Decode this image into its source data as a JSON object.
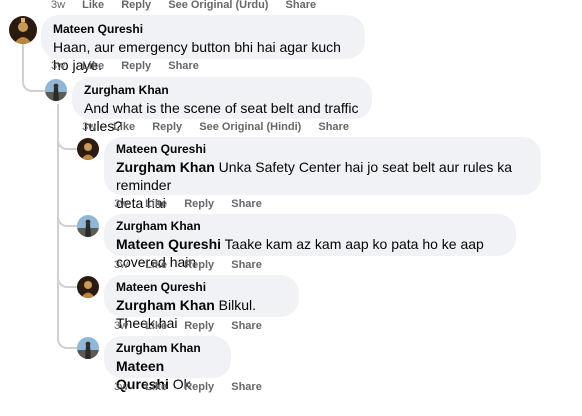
{
  "top_actions": {
    "time": "3w",
    "like": "Like",
    "reply": "Reply",
    "see_original": "See Original (Urdu)",
    "share": "Share"
  },
  "comments": [
    {
      "author": "Mateen Qureshi",
      "text": "Haan, aur emergency button bhi hai agar kuch ho jaye.",
      "time": "3w",
      "like": "Like",
      "reply": "Reply",
      "share": "Share"
    },
    {
      "author": "Zurgham Khan",
      "text": "And what is the scene of seat belt and traffic rules?",
      "time": "3w",
      "like": "Like",
      "reply": "Reply",
      "see_original": "See Original (Hindi)",
      "share": "Share"
    },
    {
      "author": "Mateen Qureshi",
      "mention": "Zurgham Khan",
      "text": "Unka Safety Center hai jo seat belt aur rules ka reminder",
      "text2": "deta hai",
      "time": "3w",
      "like": "Like",
      "reply": "Reply",
      "share": "Share"
    },
    {
      "author": "Zurgham Khan",
      "mention": "Mateen Qureshi",
      "text": "Taake kam az kam aap ko pata ho ke aap covered hain",
      "time": "3w",
      "like": "Like",
      "reply": "Reply",
      "share": "Share"
    },
    {
      "author": "Mateen Qureshi",
      "mention": "Zurgham Khan",
      "text": "Bilkul. Theek hai",
      "time": "3w",
      "like": "Like",
      "reply": "Reply",
      "share": "Share"
    },
    {
      "author": "Zurgham Khan",
      "mention": "Mateen Qureshi",
      "text": "Ok",
      "time": "3w",
      "like": "Like",
      "reply": "Reply",
      "share": "Share"
    }
  ]
}
